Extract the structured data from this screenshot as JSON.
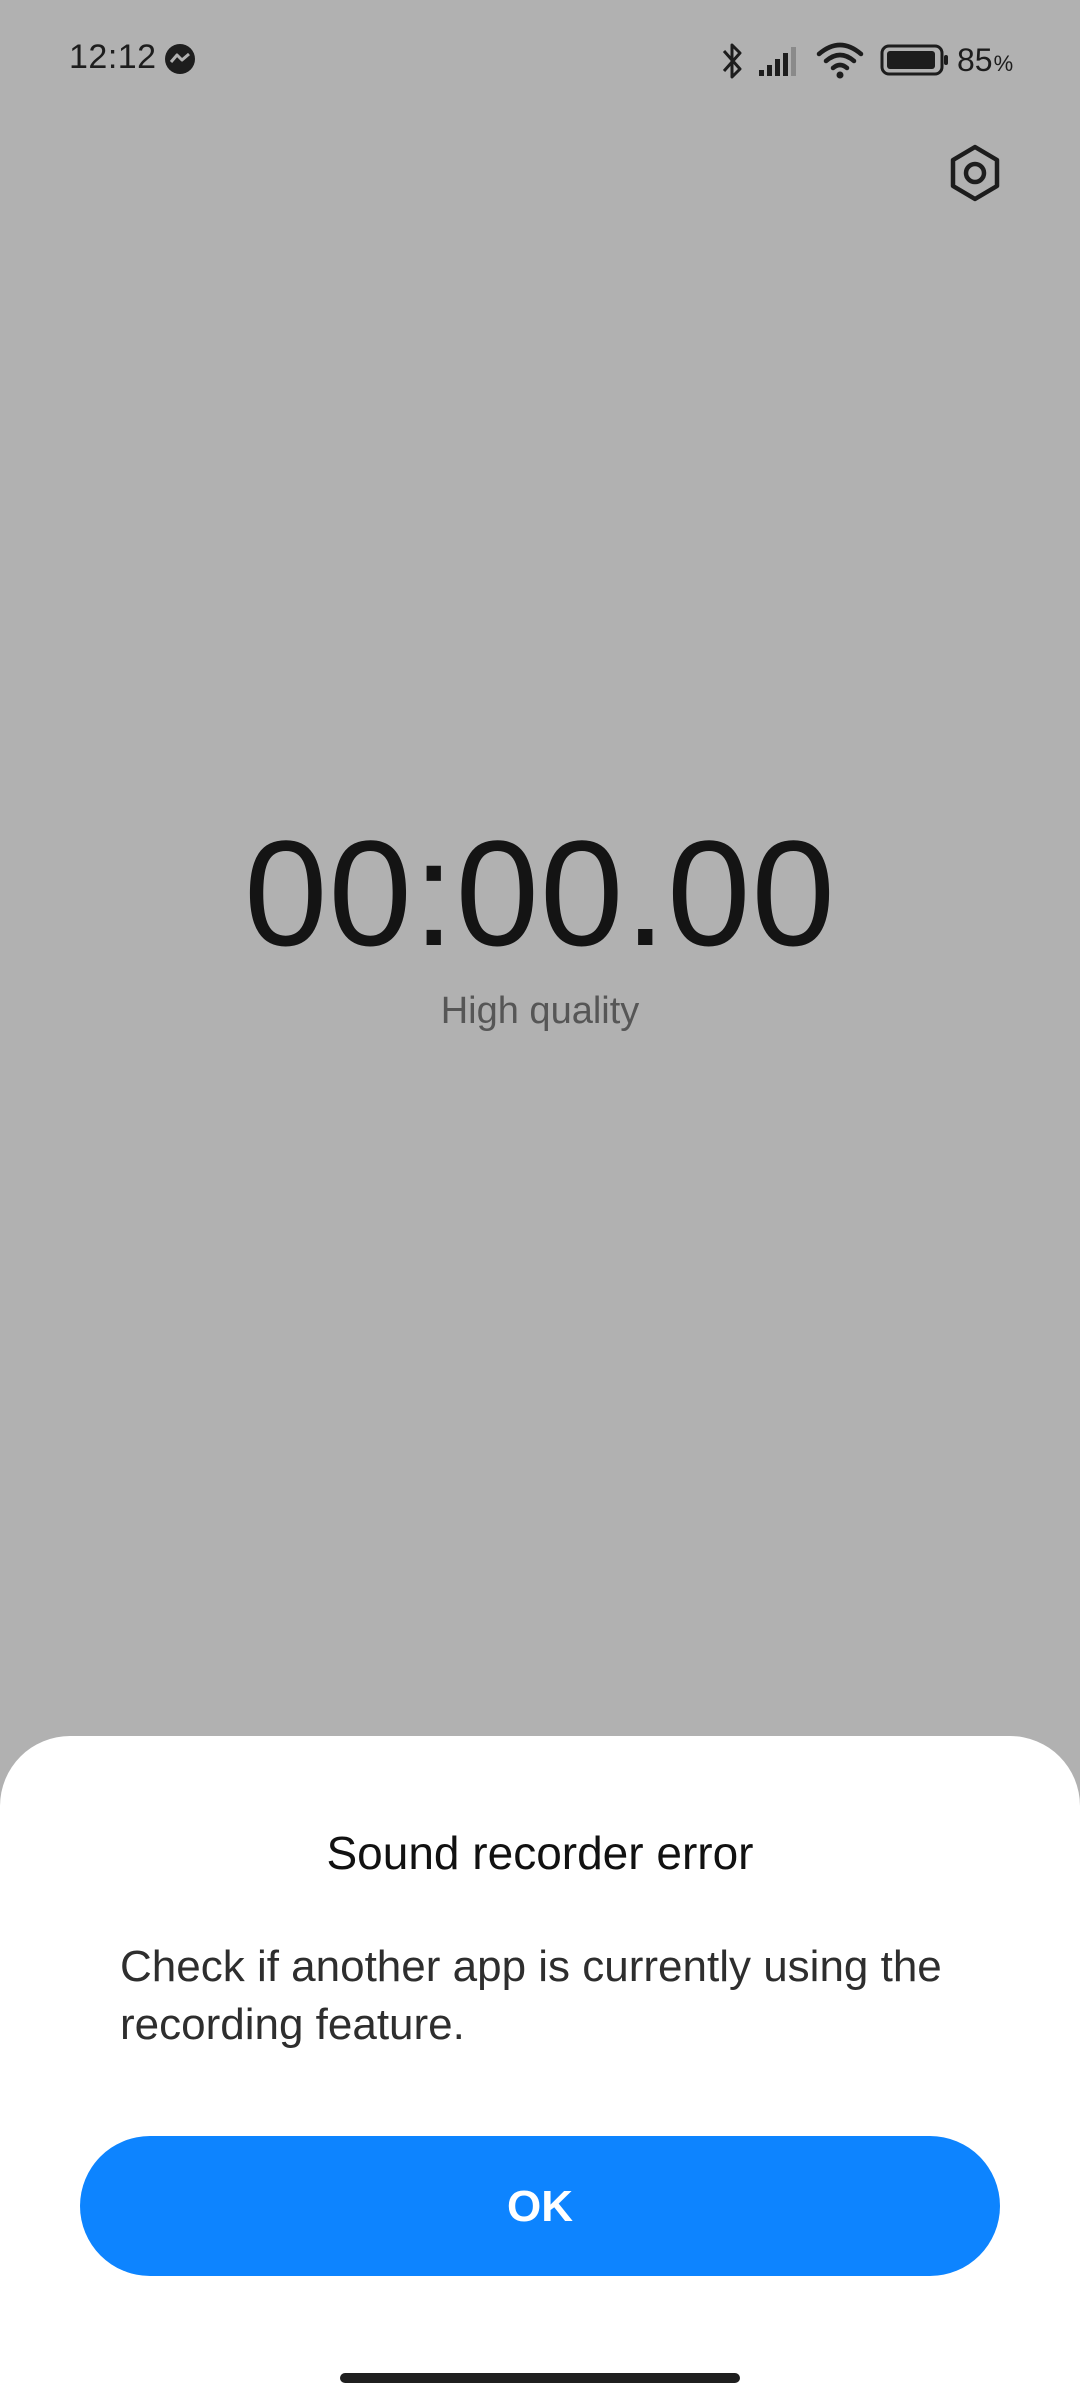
{
  "status_bar": {
    "time": "12:12",
    "battery_level": "85",
    "battery_unit": "%",
    "icons": [
      "messenger-icon",
      "bluetooth-icon",
      "signal-icon",
      "wifi-icon",
      "battery-icon"
    ]
  },
  "header": {
    "settings_icon": "settings-icon"
  },
  "recorder": {
    "timer": "00:00.00",
    "quality": "High quality"
  },
  "dialog": {
    "title": "Sound recorder error",
    "message": "Check if another app is currently using the recording feature.",
    "ok_label": "OK",
    "accent_color": "#0d84ff"
  }
}
